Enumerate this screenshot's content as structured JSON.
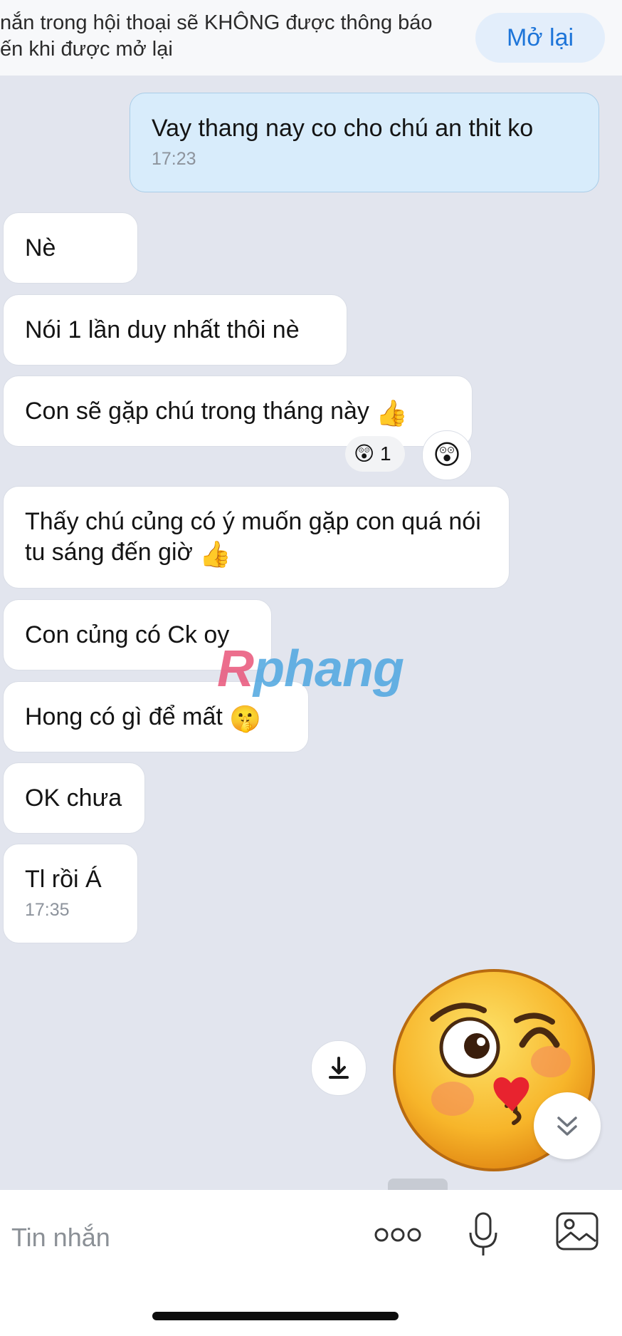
{
  "banner": {
    "notice": "nắn trong hội thoại sẽ KHÔNG được thông báo\nến khi được mở lại",
    "reopen_label": "Mở lại"
  },
  "messages": [
    {
      "direction": "outgoing",
      "text": "Vay thang nay co cho chú an thit ko",
      "time": "17:23"
    },
    {
      "direction": "incoming",
      "text": "Nè"
    },
    {
      "direction": "incoming",
      "text": "Nói 1 lần duy nhất thôi nè"
    },
    {
      "direction": "incoming",
      "text": "Con sẽ gặp chú trong tháng này",
      "emoji": "👍",
      "reaction": {
        "emoji": "😲",
        "count": "1"
      }
    },
    {
      "direction": "incoming",
      "text": "Thấy chú củng có ý muốn gặp con quá nói tu sáng đến giờ",
      "emoji": "👍"
    },
    {
      "direction": "incoming",
      "text": "Con củng có Ck oy"
    },
    {
      "direction": "incoming",
      "text": "Hong có gì để mất",
      "emoji": "🤫"
    },
    {
      "direction": "incoming",
      "text": "OK chưa"
    },
    {
      "direction": "incoming",
      "text": "Tl rồi Á",
      "time": "17:35"
    }
  ],
  "reaction_button_emoji": "😲",
  "watermark": {
    "r": "R",
    "rest": "phang"
  },
  "composer": {
    "placeholder": "Tin nhắn"
  },
  "icons": {
    "download": "download-icon",
    "sticker": "wink-kiss-emoji-sticker",
    "scroll_down": "double-chevron-down-icon",
    "more": "more-dots-icon",
    "mic": "microphone-icon",
    "image": "image-icon"
  },
  "colors": {
    "chat_background": "#e2e5ee",
    "outgoing_bubble": "#d8ecfb",
    "incoming_bubble": "#ffffff",
    "accent": "#1e75d9"
  }
}
